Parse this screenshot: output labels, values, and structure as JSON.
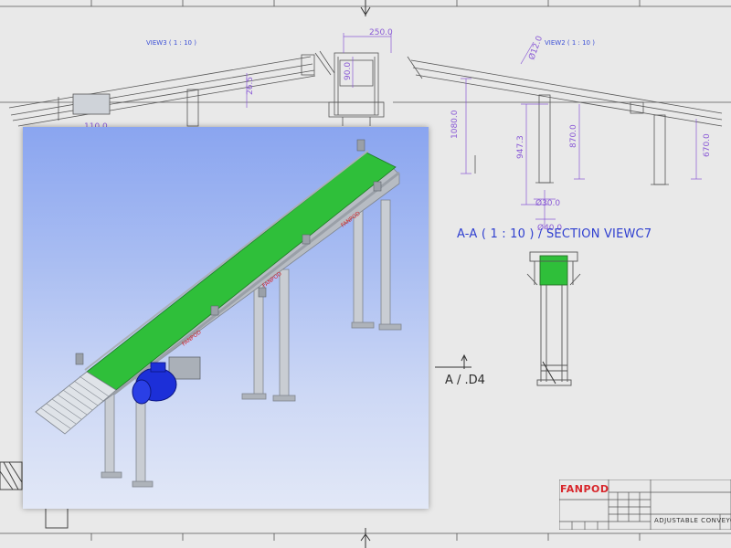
{
  "drawing": {
    "view3_label": "VIEW3 ( 1 : 10 )",
    "view2_label": "VIEW2 ( 1 : 10 )",
    "section_title": "A-A ( 1 : 10 ) / SECTION VIEWC7",
    "detail_label": "A / .D4",
    "dimensions": {
      "top_width": "250.0",
      "top_height": "90.0",
      "left_angle": "26.5",
      "left_length": "110.0",
      "total_height": "1080.0",
      "diameter_top": "Ø12.0",
      "height_a": "947.3",
      "height_b": "870.0",
      "height_c": "670.0",
      "diameter_bottom_1": "Ø30.0",
      "diameter_bottom_2": "Ø40.0"
    }
  },
  "render": {
    "brand_text": "FANPOD"
  },
  "title_block": {
    "logo": "FANPOD",
    "drawing_name": "ADJUSTABLE CONVEYOR"
  },
  "colors": {
    "belt": "#2fbf3a",
    "motor": "#1c2fd8",
    "frame": "#c9cdd3",
    "dimension": "#8a5ad6",
    "brand": "#d8262b"
  }
}
